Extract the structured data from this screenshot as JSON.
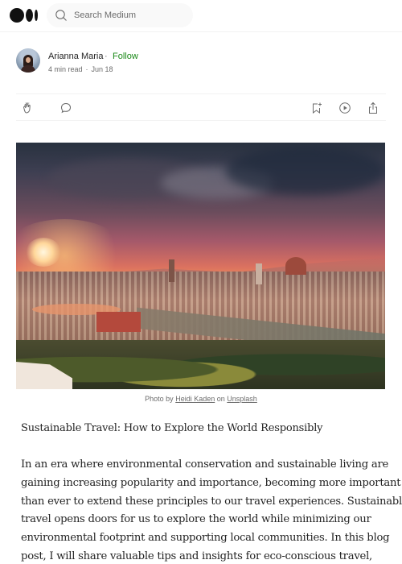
{
  "header": {
    "logo": "Medium",
    "search_placeholder": "Search Medium"
  },
  "author": {
    "name": "Arianna Maria",
    "separator": "·",
    "follow_label": "Follow",
    "read_time": "4 min read",
    "date": "Jun 18"
  },
  "actions": {
    "left": [
      {
        "name": "clap",
        "icon": "clap-icon"
      },
      {
        "name": "comment",
        "icon": "comment-icon"
      }
    ],
    "right": [
      {
        "name": "save",
        "icon": "bookmark-add-icon"
      },
      {
        "name": "listen",
        "icon": "play-icon"
      },
      {
        "name": "share",
        "icon": "share-icon"
      }
    ]
  },
  "hero": {
    "description": "Sunset over Florence skyline with Duomo and Arno river",
    "caption_prefix": "Photo by",
    "photographer": "Heidi Kaden",
    "caption_mid": "on",
    "source": "Unsplash"
  },
  "article": {
    "subtitle": "Sustainable Travel: How to Explore the World Responsibly",
    "lines": [
      "In an era where environmental conservation and sustainable living are",
      "gaining increasing popularity and importance, becoming more important",
      "than ever to extend these principles to our travel experiences. Sustainable",
      "travel opens doors for us to explore the world while minimizing our",
      "environmental footprint and supporting local communities. In this blog",
      "post, I will share valuable tips and insights for eco-conscious travel,"
    ]
  },
  "colors": {
    "text": "#242424",
    "muted": "#6b6b6b",
    "follow": "#1a8917",
    "divider": "#f2f2f2",
    "search_bg": "#f9f9f9"
  }
}
